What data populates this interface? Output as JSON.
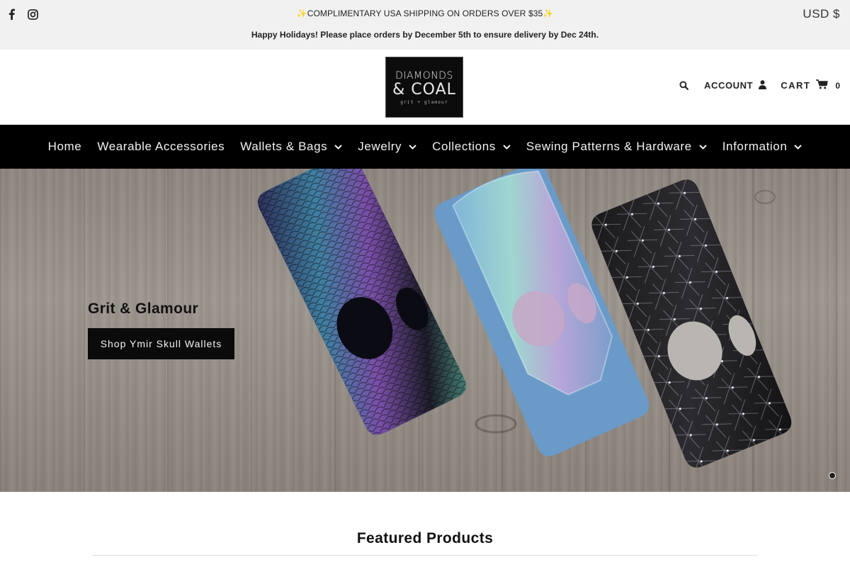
{
  "announcement": {
    "social": [
      {
        "icon": "facebook-icon"
      },
      {
        "icon": "instagram-icon"
      }
    ],
    "shipping_text": "✨COMPLIMENTARY USA SHIPPING ON ORDERS OVER $35✨",
    "holiday_text": "Happy Holidays! Please place orders by December 5th to ensure delivery by Dec 24th.",
    "currency": "USD $"
  },
  "header": {
    "logo": {
      "line1": "DIAMONDS",
      "line2": "& COAL",
      "tagline": "grit + glamour"
    },
    "search_icon": "search-icon",
    "account_label": "ACCOUNT",
    "cart_label": "CART",
    "cart_count": "0"
  },
  "nav": {
    "items": [
      {
        "label": "Home",
        "has_dropdown": false
      },
      {
        "label": "Wearable Accessories",
        "has_dropdown": false
      },
      {
        "label": "Wallets & Bags",
        "has_dropdown": true
      },
      {
        "label": "Jewelry",
        "has_dropdown": true
      },
      {
        "label": "Collections",
        "has_dropdown": true
      },
      {
        "label": "Sewing Patterns & Hardware",
        "has_dropdown": true
      },
      {
        "label": "Information",
        "has_dropdown": true
      }
    ]
  },
  "hero": {
    "title": "Grit & Glamour",
    "button_label": "Shop Ymir Skull Wallets",
    "slide_count": 1,
    "active_slide": 1
  },
  "featured": {
    "heading": "Featured Products"
  },
  "colors": {
    "nav_bg": "#000000",
    "announcement_bg": "#f1f1f1",
    "button_bg": "#0b0b0b"
  }
}
